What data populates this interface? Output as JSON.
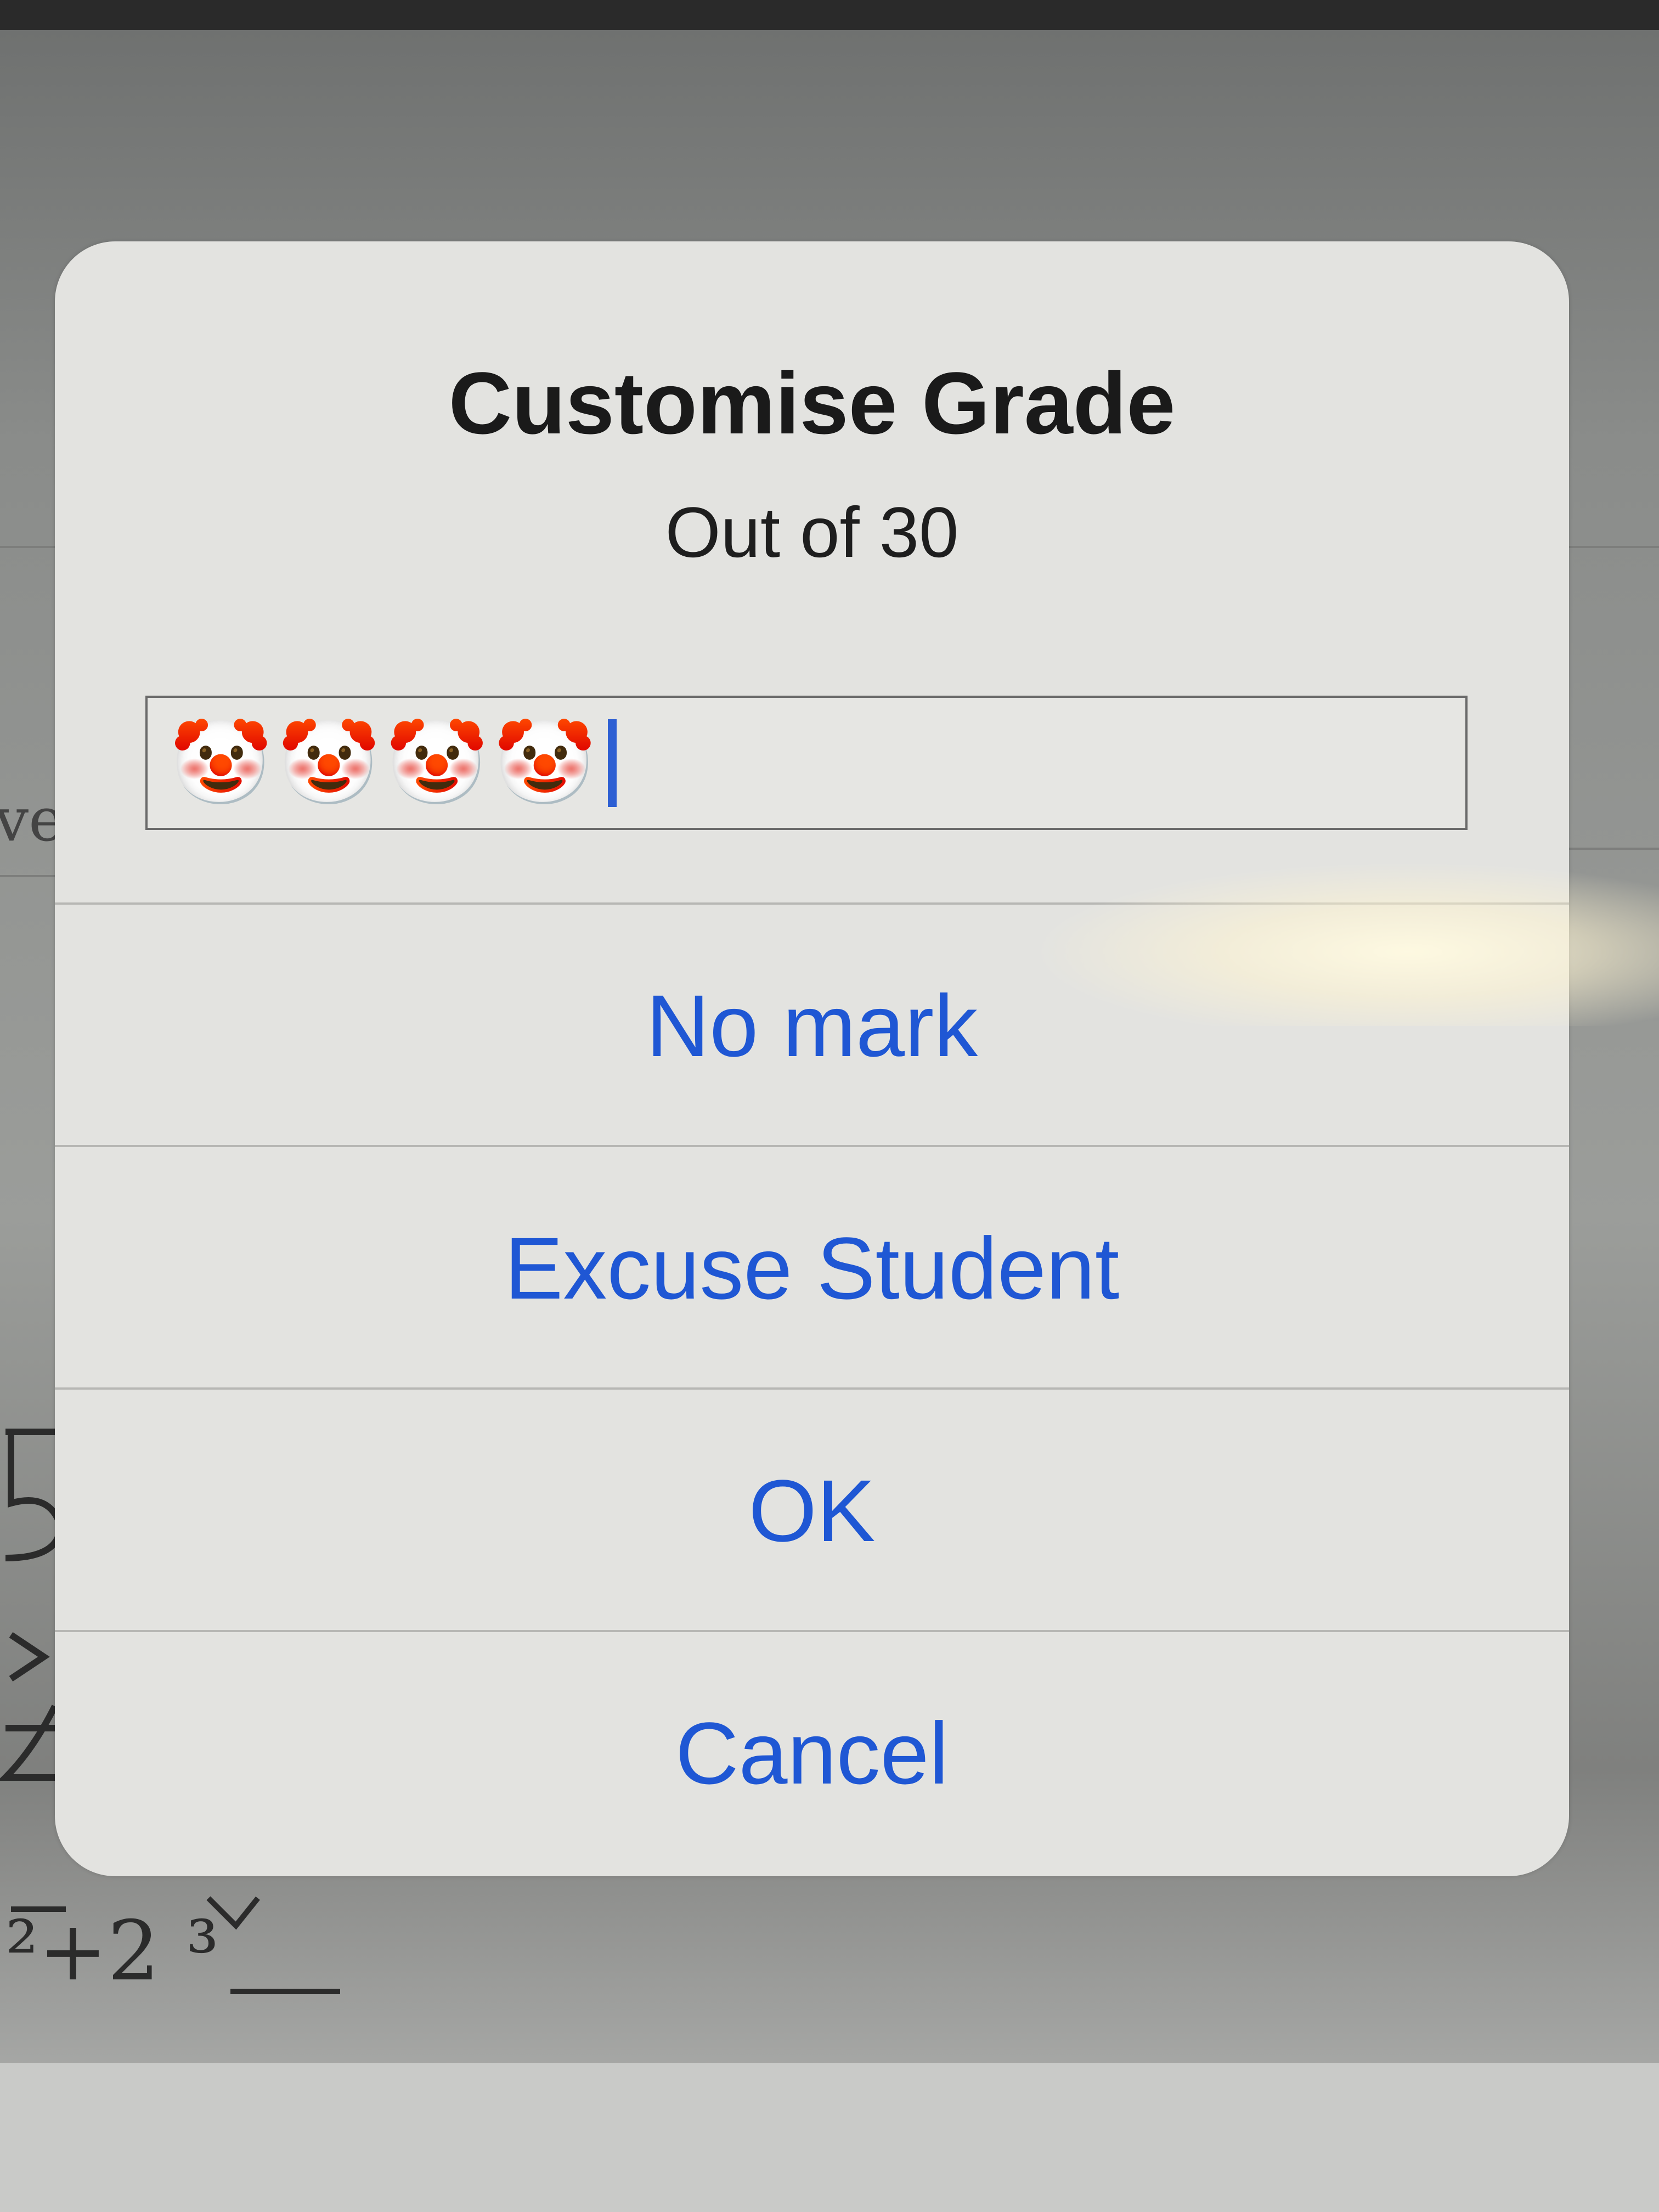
{
  "dialog": {
    "title": "Customise Grade",
    "subtitle": "Out of 30",
    "grade_input": {
      "value": "🤡🤡🤡🤡",
      "placeholder": ""
    },
    "actions": [
      {
        "label": "No mark"
      },
      {
        "label": "Excuse Student"
      },
      {
        "label": "OK"
      },
      {
        "label": "Cancel"
      }
    ]
  },
  "background": {
    "partial_text": "ve",
    "math_fragment": "²+2 ³"
  },
  "colors": {
    "accent": "#1f57d4",
    "dialog_bg": "#e3e3e0",
    "caret": "#2d5fd3"
  }
}
